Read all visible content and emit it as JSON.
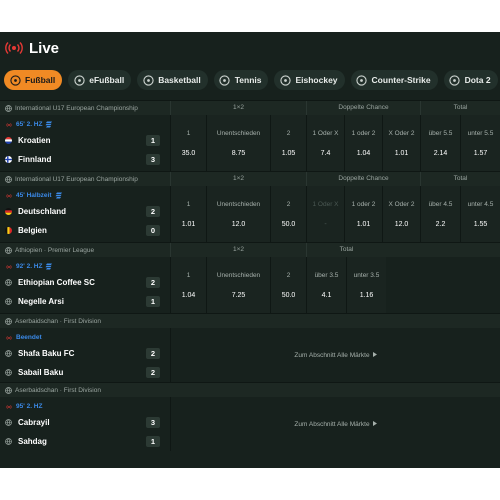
{
  "header": {
    "title": "Live",
    "accent": "#e53935"
  },
  "tabs": [
    {
      "label": "Fußball",
      "icon": "football-icon",
      "active": true
    },
    {
      "label": "eFußball",
      "icon": "controller-icon",
      "active": false
    },
    {
      "label": "Basketball",
      "icon": "basketball-icon",
      "active": false
    },
    {
      "label": "Tennis",
      "icon": "tennis-icon",
      "active": false
    },
    {
      "label": "Eishockey",
      "icon": "hockey-icon",
      "active": false
    },
    {
      "label": "Counter-Strike",
      "icon": "counter-strike-icon",
      "active": false
    },
    {
      "label": "Dota 2",
      "icon": "dota-icon",
      "active": false
    }
  ],
  "events": [
    {
      "league": "International U17 European Championship",
      "markets": [
        "1×2",
        "Doppelte Chance",
        "Total"
      ],
      "status": "65' 2. HZ",
      "teams": [
        {
          "name": "Kroatien",
          "score": "1",
          "flag": "croatia"
        },
        {
          "name": "Finnland",
          "score": "3",
          "flag": "finland"
        }
      ],
      "odds": [
        {
          "label": "1",
          "value": "35.0"
        },
        {
          "label": "Unentschieden",
          "value": "8.75"
        },
        {
          "label": "2",
          "value": "1.05"
        },
        {
          "label": "1 Oder X",
          "value": "7.4"
        },
        {
          "label": "1 oder 2",
          "value": "1.04"
        },
        {
          "label": "X Oder 2",
          "value": "1.01"
        },
        {
          "label": "über 5.5",
          "value": "2.14"
        },
        {
          "label": "unter 5.5",
          "value": "1.57"
        }
      ]
    },
    {
      "league": "International U17 European Championship",
      "markets": [
        "1×2",
        "Doppelte Chance",
        "Total"
      ],
      "status": "45' Halbzeit",
      "teams": [
        {
          "name": "Deutschland",
          "score": "2",
          "flag": "germany"
        },
        {
          "name": "Belgien",
          "score": "0",
          "flag": "belgium"
        }
      ],
      "odds": [
        {
          "label": "1",
          "value": "1.01"
        },
        {
          "label": "Unentschieden",
          "value": "12.0"
        },
        {
          "label": "2",
          "value": "50.0"
        },
        {
          "label": "1 Oder X",
          "value": "-",
          "disabled": true
        },
        {
          "label": "1 oder 2",
          "value": "1.01"
        },
        {
          "label": "X Oder 2",
          "value": "12.0"
        },
        {
          "label": "über 4.5",
          "value": "2.2"
        },
        {
          "label": "unter 4.5",
          "value": "1.55"
        }
      ]
    },
    {
      "league": "Äthiopien · Premier League",
      "markets": [
        "1×2",
        "Total"
      ],
      "status": "92' 2. HZ",
      "teams": [
        {
          "name": "Ethiopian Coffee SC",
          "score": "2",
          "flag": "globe"
        },
        {
          "name": "Negelle Arsi",
          "score": "1",
          "flag": "globe"
        }
      ],
      "odds": [
        {
          "label": "1",
          "value": "1.04"
        },
        {
          "label": "Unentschieden",
          "value": "7.25"
        },
        {
          "label": "2",
          "value": "50.0"
        },
        {
          "label": "über 3.5",
          "value": "4.1"
        },
        {
          "label": "unter 3.5",
          "value": "1.16"
        }
      ]
    },
    {
      "league": "Aserbaidschan · First Division",
      "status": "Beendet",
      "teams": [
        {
          "name": "Shafa Baku FC",
          "score": "2",
          "flag": "globe"
        },
        {
          "name": "Sabail Baku",
          "score": "2",
          "flag": "globe"
        }
      ],
      "more_label": "Zum Abschnitt Alle Märkte"
    },
    {
      "league": "Aserbaidschan · First Division",
      "status": "95' 2. HZ",
      "teams": [
        {
          "name": "Cabrayil",
          "score": "3",
          "flag": "globe"
        },
        {
          "name": "Sahdag",
          "score": "1",
          "flag": "globe"
        }
      ],
      "more_label": "Zum Abschnitt Alle Märkte"
    }
  ]
}
